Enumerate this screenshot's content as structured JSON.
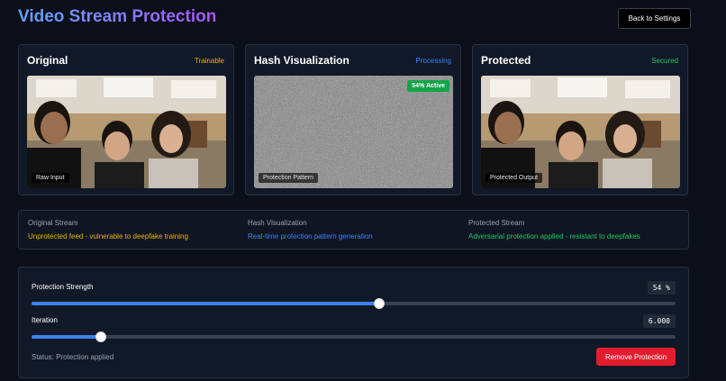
{
  "header": {
    "title": "Video Stream Protection",
    "back_label": "Back to Settings"
  },
  "panels": [
    {
      "title": "Original",
      "status": "Trainable",
      "status_color": "#eab308",
      "frame_label": "Raw Input"
    },
    {
      "title": "Hash Visualization",
      "status": "Processing",
      "status_color": "#3b82f6",
      "frame_label": "Protection Pattern",
      "active_badge": "54% Active"
    },
    {
      "title": "Protected",
      "status": "Secured",
      "status_color": "#22c55e",
      "frame_label": "Protected Output"
    }
  ],
  "info": [
    {
      "heading": "Original Stream",
      "text": "Unprotected feed - vulnerable to deepfake training",
      "color": "#eab308"
    },
    {
      "heading": "Hash Visualization",
      "text": "Real-time protection pattern generation",
      "color": "#3b82f6"
    },
    {
      "heading": "Protected Stream",
      "text": "Adversarial protection applied - resistant to deepfakes",
      "color": "#22c55e"
    }
  ],
  "controls": {
    "strength_label": "Protection Strength",
    "strength_value": "54 %",
    "strength_fraction": 0.54,
    "iteration_label": "Iteration",
    "iteration_value": "6.000",
    "iteration_fraction": 0.108,
    "status": "Status: Protection applied",
    "remove_label": "Remove Protection"
  }
}
